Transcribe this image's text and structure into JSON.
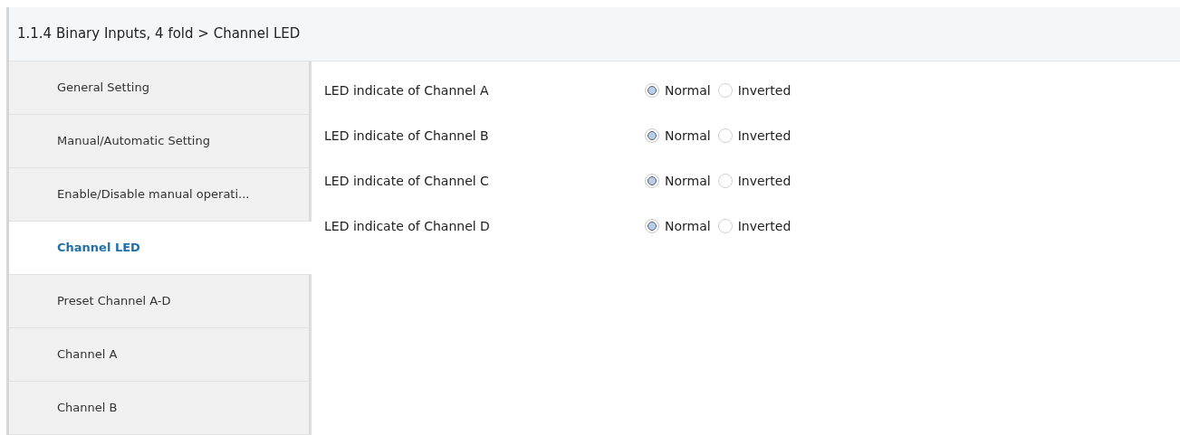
{
  "breadcrumb": "1.1.4 Binary Inputs, 4 fold > Channel LED",
  "sidebar": {
    "items": [
      {
        "label": "General Setting",
        "selected": false
      },
      {
        "label": "Manual/Automatic Setting",
        "selected": false
      },
      {
        "label": "Enable/Disable manual operati...",
        "selected": false
      },
      {
        "label": "Channel LED",
        "selected": true
      },
      {
        "label": "Preset Channel A-D",
        "selected": false
      },
      {
        "label": "Channel A",
        "selected": false
      },
      {
        "label": "Channel B",
        "selected": false
      }
    ]
  },
  "parameters": [
    {
      "label": "LED indicate of Channel A",
      "options": [
        {
          "label": "Normal",
          "selected": true
        },
        {
          "label": "Inverted",
          "selected": false
        }
      ]
    },
    {
      "label": "LED indicate of Channel B",
      "options": [
        {
          "label": "Normal",
          "selected": true
        },
        {
          "label": "Inverted",
          "selected": false
        }
      ]
    },
    {
      "label": "LED indicate of Channel C",
      "options": [
        {
          "label": "Normal",
          "selected": true
        },
        {
          "label": "Inverted",
          "selected": false
        }
      ]
    },
    {
      "label": "LED indicate of Channel D",
      "options": [
        {
          "label": "Normal",
          "selected": true
        },
        {
          "label": "Inverted",
          "selected": false
        }
      ]
    }
  ]
}
